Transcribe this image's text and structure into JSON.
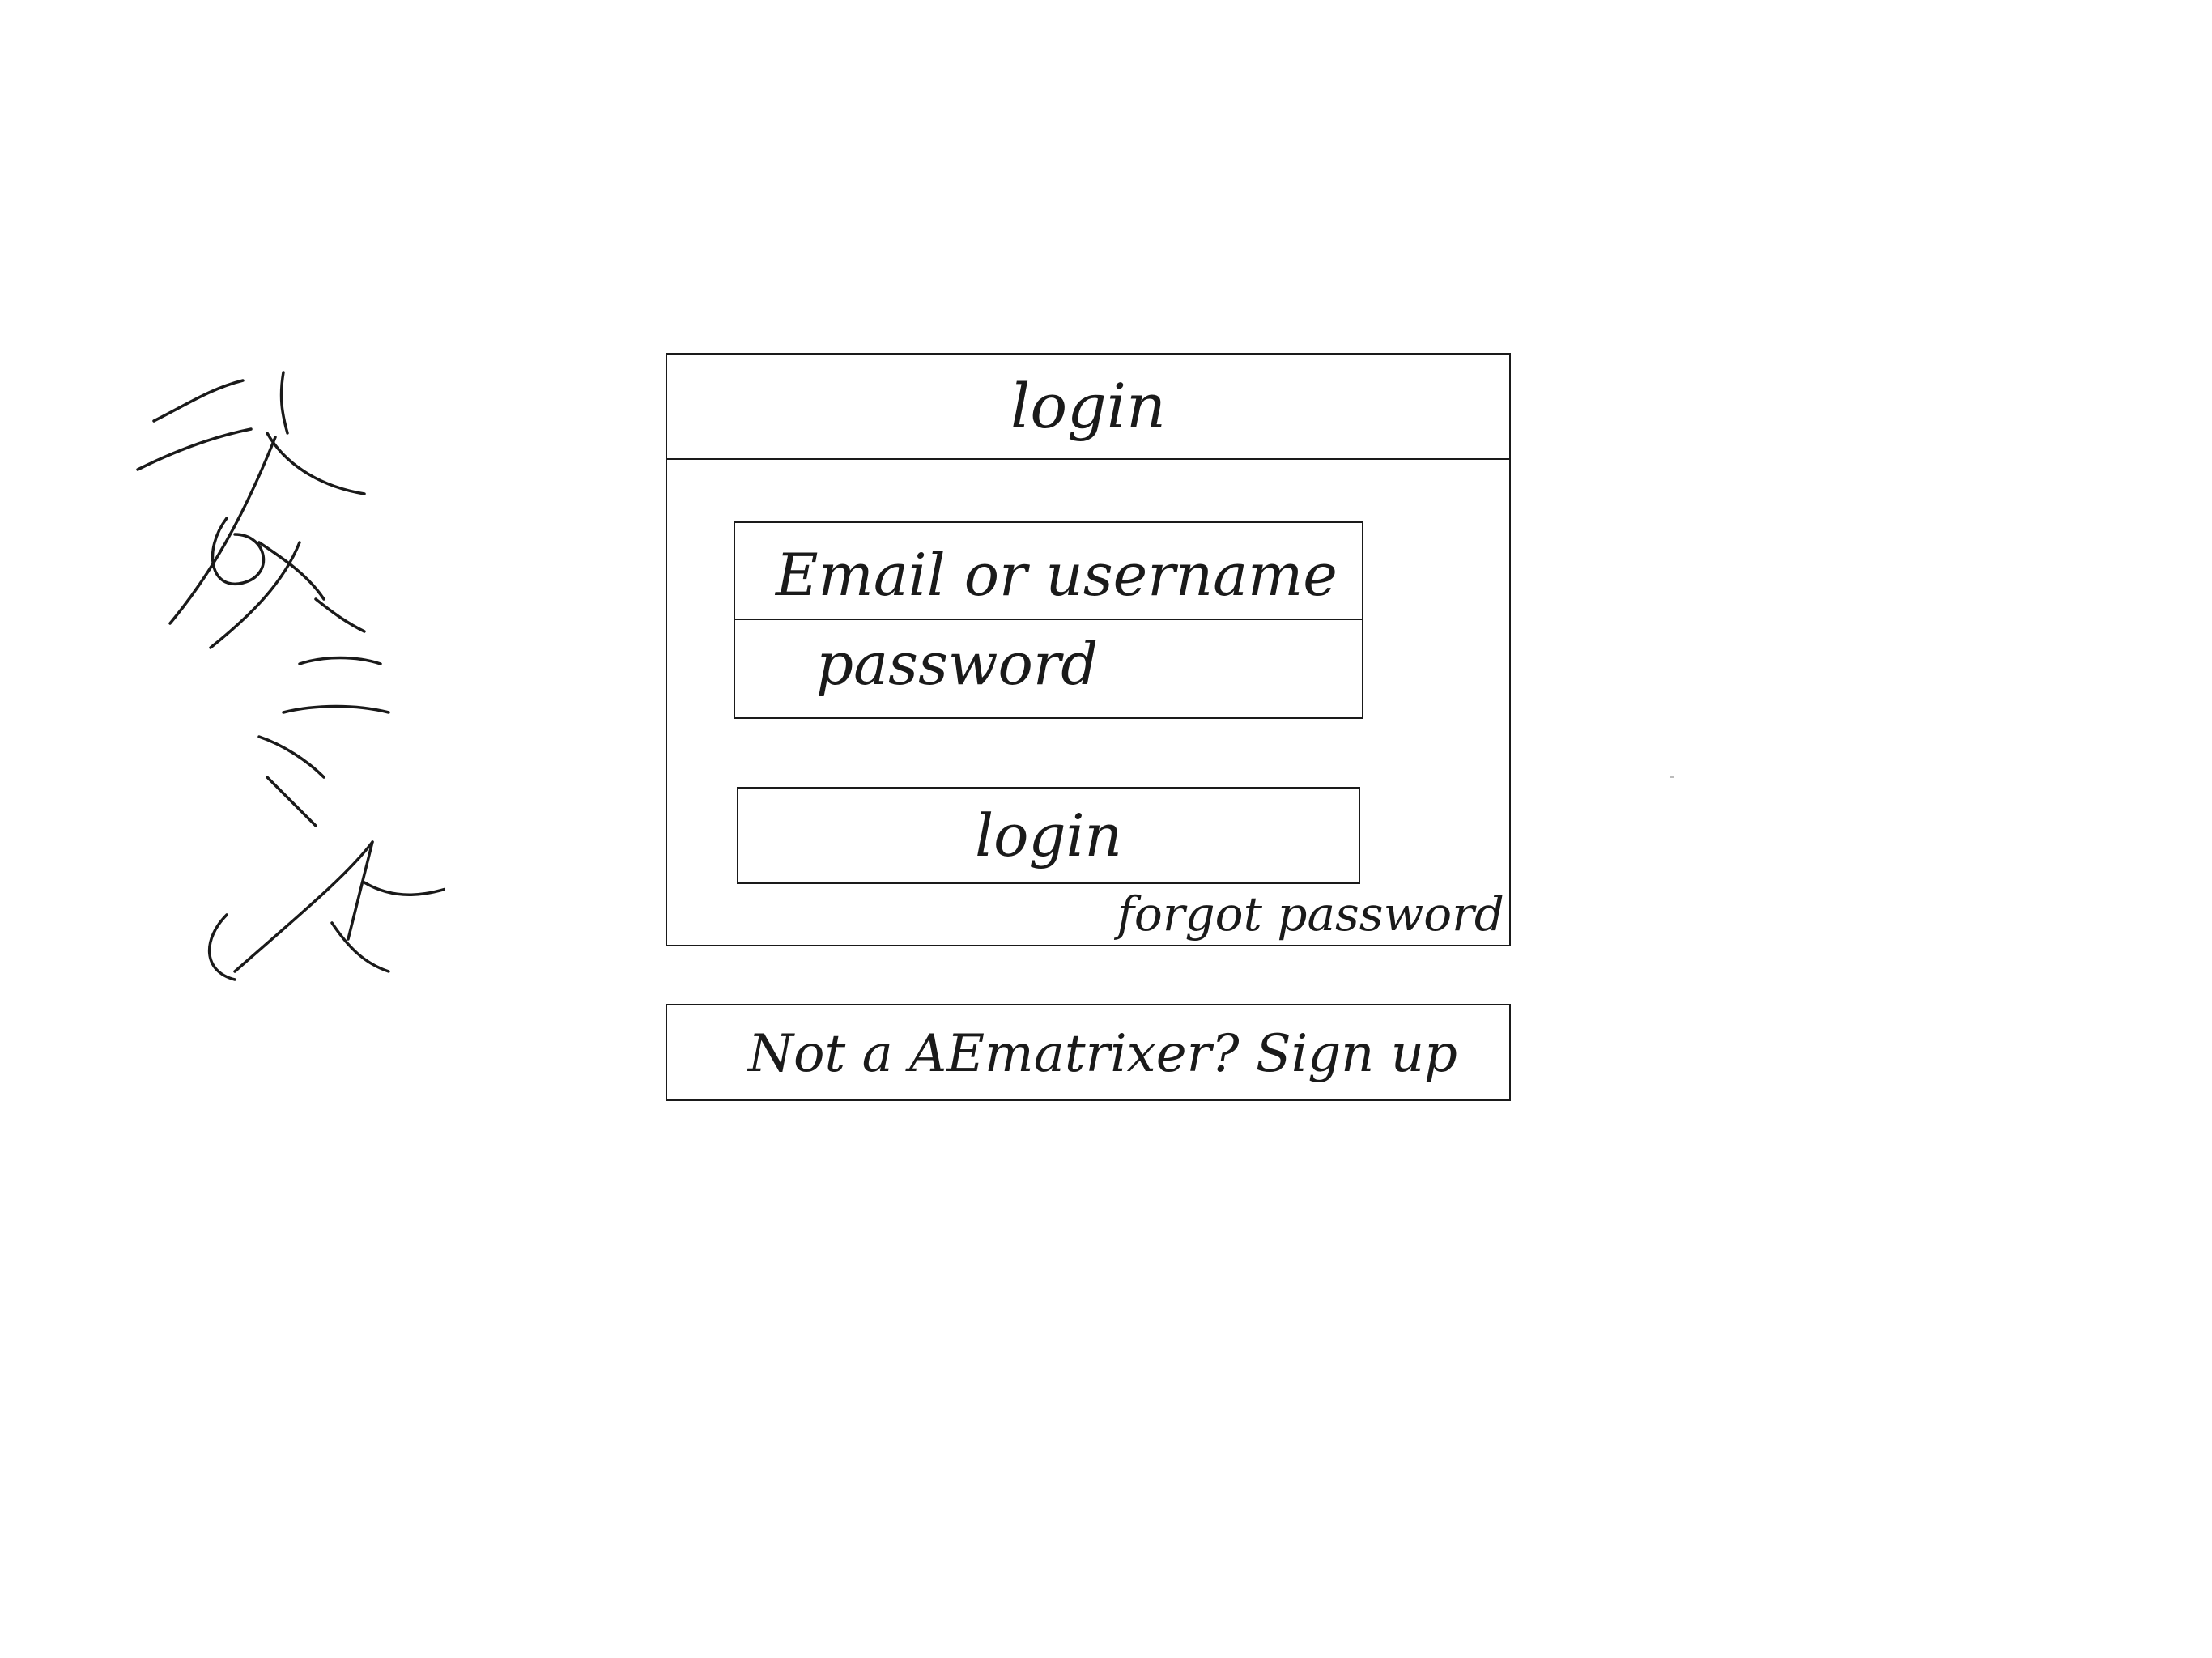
{
  "card": {
    "title": "login"
  },
  "form": {
    "email_label": "Email or username",
    "password_label": "password",
    "login_button_label": "login",
    "forgot_password_label": "forgot password"
  },
  "signup": {
    "prompt_label": "Not a AEmatrixer? Sign up"
  },
  "colors": {
    "ink": "#1a1a1a",
    "background": "#ffffff"
  }
}
